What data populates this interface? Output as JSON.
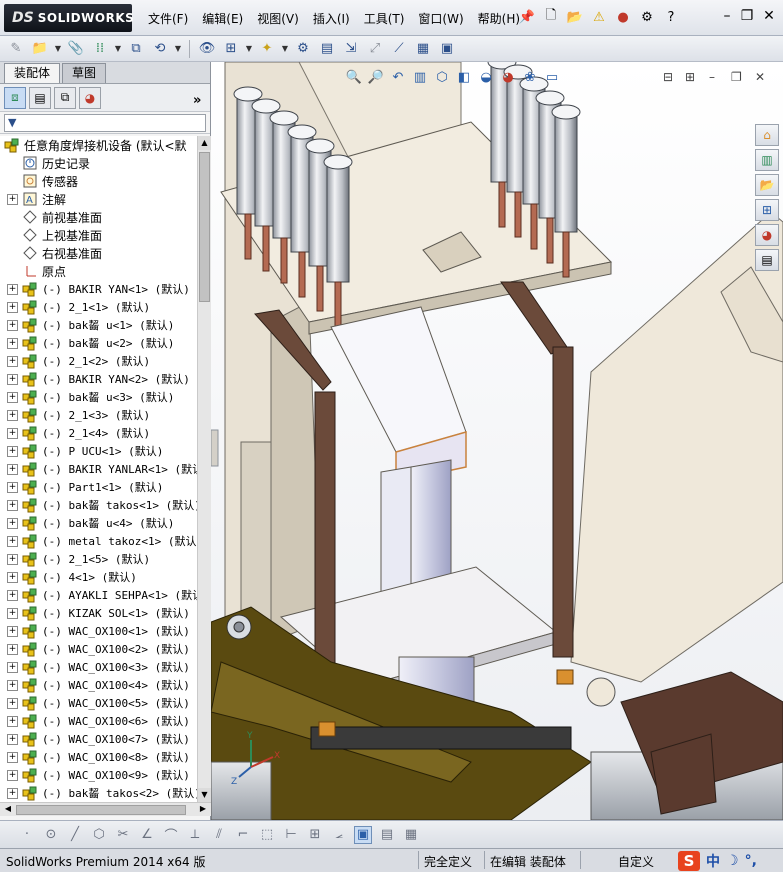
{
  "app": {
    "logo_prefix": "DS",
    "logo_name": "SOLIDWORKS"
  },
  "menu": [
    {
      "label": "文件(F)"
    },
    {
      "label": "编辑(E)"
    },
    {
      "label": "视图(V)"
    },
    {
      "label": "插入(I)"
    },
    {
      "label": "工具(T)"
    },
    {
      "label": "窗口(W)"
    },
    {
      "label": "帮助(H)"
    }
  ],
  "menu_right": {
    "help_label": "?"
  },
  "tabs": [
    {
      "label": "装配体",
      "active": true
    },
    {
      "label": "草图",
      "active": false
    }
  ],
  "panel": {
    "more_label": "»",
    "filter_label": "▼"
  },
  "tree": {
    "root": "任意角度焊接机设备  (默认<默",
    "fixed": [
      {
        "label": "历史记录",
        "icon": "history-icon",
        "expand": false
      },
      {
        "label": "传感器",
        "icon": "sensor-icon",
        "expand": false
      },
      {
        "label": "注解",
        "icon": "annotation-icon",
        "expand": true
      },
      {
        "label": "前视基准面",
        "icon": "plane-icon",
        "expand": false
      },
      {
        "label": "上视基准面",
        "icon": "plane-icon",
        "expand": false
      },
      {
        "label": "右视基准面",
        "icon": "plane-icon",
        "expand": false
      },
      {
        "label": "原点",
        "icon": "origin-icon",
        "expand": false
      }
    ],
    "components": [
      "(-) BAKIR YAN<1> (默认)",
      "(-) 2_1<1> (默认)",
      "(-) bak齧 u<1> (默认)",
      "(-) bak齧 u<2> (默认)",
      "(-) 2_1<2> (默认)",
      "(-) BAKIR YAN<2> (默认)",
      "(-) bak齧 u<3> (默认)",
      "(-) 2_1<3> (默认)",
      "(-) 2_1<4> (默认)",
      "(-) P UCU<1> (默认)",
      "(-) BAKIR YANLAR<1> (默认",
      "(-) Part1<1> (默认)",
      "(-) bak齧 takos<1> (默认)",
      "(-) bak齧 u<4> (默认)",
      "(-) metal takoz<1> (默认)",
      "(-) 2_1<5> (默认)",
      "(-) 4<1> (默认)",
      "(-) AYAKLI SEHPA<1> (默认",
      "(-) KIZAK SOL<1> (默认)",
      "(-) WAC_OX100<1> (默认)",
      "(-) WAC_OX100<2> (默认)",
      "(-) WAC_OX100<3> (默认)",
      "(-) WAC_OX100<4> (默认)",
      "(-) WAC_OX100<5> (默认)",
      "(-) WAC_OX100<6> (默认)",
      "(-) WAC_OX100<7> (默认)",
      "(-) WAC_OX100<8> (默认)",
      "(-) WAC_OX100<9> (默认)",
      "(-) bak齧 takos<2> (默认)"
    ]
  },
  "status": {
    "version": "SolidWorks Premium 2014 x64 版",
    "defined": "完全定义",
    "editing": "在编辑 装配体",
    "custom": "自定义",
    "ime_logo": "S",
    "ime_lang": "中",
    "ime_moon": "☽",
    "ime_punct": "°,"
  },
  "axes": {
    "x": "X",
    "y": "Y",
    "z": "Z"
  },
  "colors": {
    "olive": "#5a4a10",
    "plate": "#f2ece0",
    "frame": "#6b4a3a",
    "column": "#b8bad6",
    "machine": "#ebe4d6",
    "rust": "#c9823d"
  }
}
